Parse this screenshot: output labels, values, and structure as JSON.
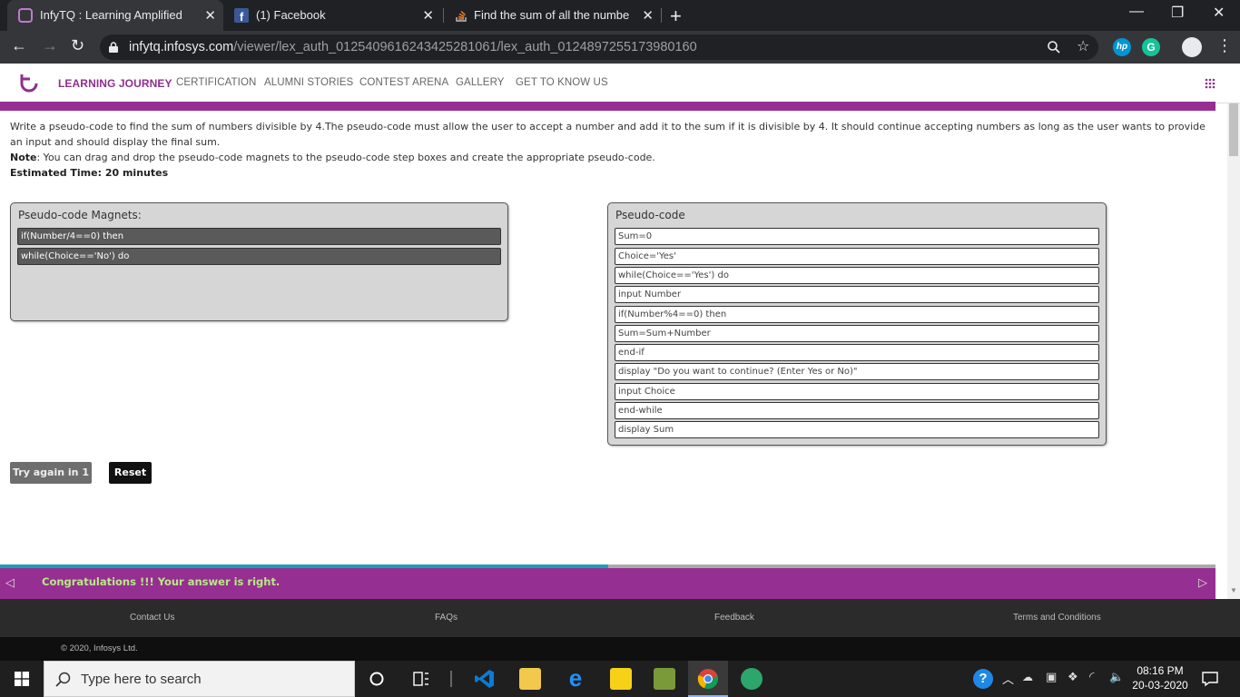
{
  "browser": {
    "tabs": [
      {
        "title": "InfyTQ : Learning Amplified",
        "icon": "infytq-icon",
        "active": true
      },
      {
        "title": "(1) Facebook",
        "icon": "facebook-icon",
        "active": false
      },
      {
        "title": "Find the sum of all the numbers",
        "icon": "stackoverflow-icon",
        "active": false
      }
    ],
    "new_tab_icon": "+",
    "url_host": "infytq.infosys.com",
    "url_path": "/viewer/lex_auth_012540961624342528106 1/lex_auth_0124897255173980160"
  },
  "site": {
    "nav": [
      {
        "label": "LEARNING JOURNEY",
        "active": true
      },
      {
        "label": "CERTIFICATION"
      },
      {
        "label": "ALUMNI STORIES"
      },
      {
        "label": "CONTEST ARENA"
      },
      {
        "label": "GALLERY"
      },
      {
        "label": "GET TO KNOW US"
      }
    ],
    "brand_color": "#962f92"
  },
  "question": {
    "text": "Write a pseudo-code to find the sum of numbers divisible by 4.The pseudo-code must allow the user to accept a number and add it to the sum if it is divisible by 4. It should continue accepting numbers as long as the user wants to provide an input and should display the final sum.",
    "note_label": "Note",
    "note_text": ": You can drag and drop the pseudo-code magnets to the pseudo-code step boxes and create the appropriate pseudo-code.",
    "time": "Estimated Time: 20 minutes"
  },
  "magnets": {
    "title": "Pseudo-code Magnets:",
    "items": [
      "if(Number/4==0) then",
      "while(Choice=='No') do"
    ]
  },
  "pseudocode": {
    "title": "Pseudo-code",
    "steps": [
      "Sum=0",
      "Choice='Yes'",
      "while(Choice=='Yes') do",
      "input Number",
      "if(Number%4==0) then",
      "Sum=Sum+Number",
      "end-if",
      "display \"Do you want to continue? (Enter Yes or No)\"",
      "input Choice",
      "end-while",
      "display Sum"
    ]
  },
  "buttons": {
    "try_again": "Try again in 1",
    "reset": "Reset"
  },
  "result": {
    "message": "Congratulations !!! Your answer is right.",
    "progress": 0.5
  },
  "footer": {
    "links": [
      "Contact Us",
      "FAQs",
      "Feedback",
      "Terms and Conditions"
    ],
    "copyright": "© 2020, Infosys Ltd."
  },
  "taskbar": {
    "search_placeholder": "Type here to search",
    "time": "08:16 PM",
    "date": "20-03-2020"
  }
}
